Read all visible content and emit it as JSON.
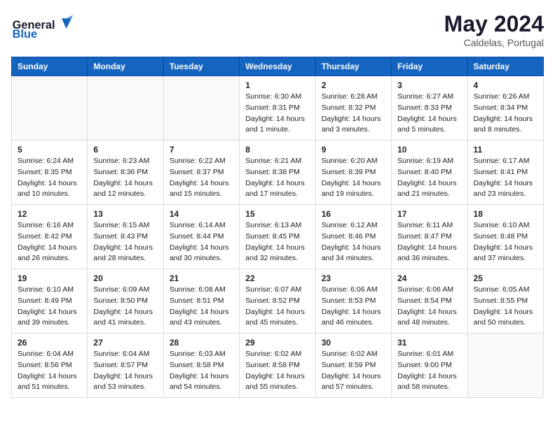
{
  "header": {
    "logo_general": "General",
    "logo_blue": "Blue",
    "title": "May 2024",
    "subtitle": "Caldelas, Portugal"
  },
  "weekdays": [
    "Sunday",
    "Monday",
    "Tuesday",
    "Wednesday",
    "Thursday",
    "Friday",
    "Saturday"
  ],
  "weeks": [
    [
      {
        "day": "",
        "info": ""
      },
      {
        "day": "",
        "info": ""
      },
      {
        "day": "",
        "info": ""
      },
      {
        "day": "1",
        "info": "Sunrise: 6:30 AM\nSunset: 8:31 PM\nDaylight: 14 hours\nand 1 minute."
      },
      {
        "day": "2",
        "info": "Sunrise: 6:28 AM\nSunset: 8:32 PM\nDaylight: 14 hours\nand 3 minutes."
      },
      {
        "day": "3",
        "info": "Sunrise: 6:27 AM\nSunset: 8:33 PM\nDaylight: 14 hours\nand 5 minutes."
      },
      {
        "day": "4",
        "info": "Sunrise: 6:26 AM\nSunset: 8:34 PM\nDaylight: 14 hours\nand 8 minutes."
      }
    ],
    [
      {
        "day": "5",
        "info": "Sunrise: 6:24 AM\nSunset: 8:35 PM\nDaylight: 14 hours\nand 10 minutes."
      },
      {
        "day": "6",
        "info": "Sunrise: 6:23 AM\nSunset: 8:36 PM\nDaylight: 14 hours\nand 12 minutes."
      },
      {
        "day": "7",
        "info": "Sunrise: 6:22 AM\nSunset: 8:37 PM\nDaylight: 14 hours\nand 15 minutes."
      },
      {
        "day": "8",
        "info": "Sunrise: 6:21 AM\nSunset: 8:38 PM\nDaylight: 14 hours\nand 17 minutes."
      },
      {
        "day": "9",
        "info": "Sunrise: 6:20 AM\nSunset: 8:39 PM\nDaylight: 14 hours\nand 19 minutes."
      },
      {
        "day": "10",
        "info": "Sunrise: 6:19 AM\nSunset: 8:40 PM\nDaylight: 14 hours\nand 21 minutes."
      },
      {
        "day": "11",
        "info": "Sunrise: 6:17 AM\nSunset: 8:41 PM\nDaylight: 14 hours\nand 23 minutes."
      }
    ],
    [
      {
        "day": "12",
        "info": "Sunrise: 6:16 AM\nSunset: 8:42 PM\nDaylight: 14 hours\nand 26 minutes."
      },
      {
        "day": "13",
        "info": "Sunrise: 6:15 AM\nSunset: 8:43 PM\nDaylight: 14 hours\nand 28 minutes."
      },
      {
        "day": "14",
        "info": "Sunrise: 6:14 AM\nSunset: 8:44 PM\nDaylight: 14 hours\nand 30 minutes."
      },
      {
        "day": "15",
        "info": "Sunrise: 6:13 AM\nSunset: 8:45 PM\nDaylight: 14 hours\nand 32 minutes."
      },
      {
        "day": "16",
        "info": "Sunrise: 6:12 AM\nSunset: 8:46 PM\nDaylight: 14 hours\nand 34 minutes."
      },
      {
        "day": "17",
        "info": "Sunrise: 6:11 AM\nSunset: 8:47 PM\nDaylight: 14 hours\nand 36 minutes."
      },
      {
        "day": "18",
        "info": "Sunrise: 6:10 AM\nSunset: 8:48 PM\nDaylight: 14 hours\nand 37 minutes."
      }
    ],
    [
      {
        "day": "19",
        "info": "Sunrise: 6:10 AM\nSunset: 8:49 PM\nDaylight: 14 hours\nand 39 minutes."
      },
      {
        "day": "20",
        "info": "Sunrise: 6:09 AM\nSunset: 8:50 PM\nDaylight: 14 hours\nand 41 minutes."
      },
      {
        "day": "21",
        "info": "Sunrise: 6:08 AM\nSunset: 8:51 PM\nDaylight: 14 hours\nand 43 minutes."
      },
      {
        "day": "22",
        "info": "Sunrise: 6:07 AM\nSunset: 8:52 PM\nDaylight: 14 hours\nand 45 minutes."
      },
      {
        "day": "23",
        "info": "Sunrise: 6:06 AM\nSunset: 8:53 PM\nDaylight: 14 hours\nand 46 minutes."
      },
      {
        "day": "24",
        "info": "Sunrise: 6:06 AM\nSunset: 8:54 PM\nDaylight: 14 hours\nand 48 minutes."
      },
      {
        "day": "25",
        "info": "Sunrise: 6:05 AM\nSunset: 8:55 PM\nDaylight: 14 hours\nand 50 minutes."
      }
    ],
    [
      {
        "day": "26",
        "info": "Sunrise: 6:04 AM\nSunset: 8:56 PM\nDaylight: 14 hours\nand 51 minutes."
      },
      {
        "day": "27",
        "info": "Sunrise: 6:04 AM\nSunset: 8:57 PM\nDaylight: 14 hours\nand 53 minutes."
      },
      {
        "day": "28",
        "info": "Sunrise: 6:03 AM\nSunset: 8:58 PM\nDaylight: 14 hours\nand 54 minutes."
      },
      {
        "day": "29",
        "info": "Sunrise: 6:02 AM\nSunset: 8:58 PM\nDaylight: 14 hours\nand 55 minutes."
      },
      {
        "day": "30",
        "info": "Sunrise: 6:02 AM\nSunset: 8:59 PM\nDaylight: 14 hours\nand 57 minutes."
      },
      {
        "day": "31",
        "info": "Sunrise: 6:01 AM\nSunset: 9:00 PM\nDaylight: 14 hours\nand 58 minutes."
      },
      {
        "day": "",
        "info": ""
      }
    ]
  ]
}
